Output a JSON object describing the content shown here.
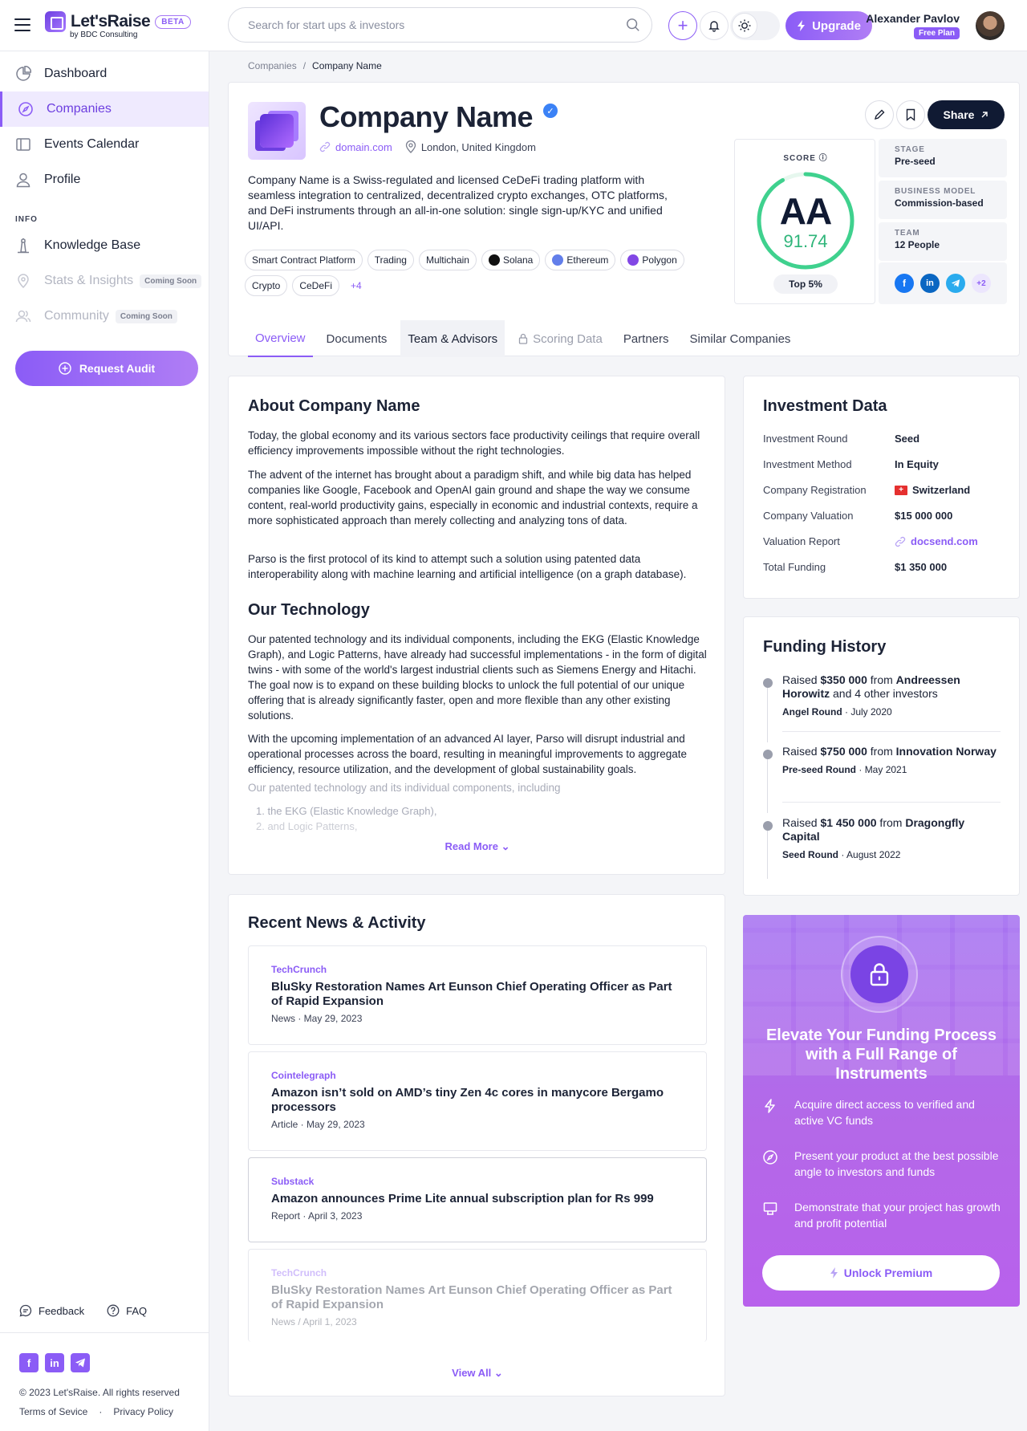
{
  "brand": {
    "name": "Let'sRaise",
    "sub": "by BDC Consulting",
    "badge": "BETA"
  },
  "search": {
    "placeholder": "Search for start ups & investors"
  },
  "topbar": {
    "upgrade_label": "Upgrade"
  },
  "user": {
    "name": "Alexander Pavlov",
    "plan": "Free Plan"
  },
  "sidebar": {
    "items": [
      {
        "label": "Dashboard"
      },
      {
        "label": "Companies"
      },
      {
        "label": "Events Calendar"
      },
      {
        "label": "Profile"
      }
    ],
    "section": "INFO",
    "info_items": [
      {
        "label": "Knowledge Base"
      },
      {
        "label": "Stats & Insights",
        "badge": "Coming Soon"
      },
      {
        "label": "Community",
        "badge": "Coming Soon"
      }
    ],
    "request_audit": "Request Audit",
    "feedback": "Feedback",
    "faq": "FAQ",
    "copyright": "© 2023 Let'sRaise. All rights reserved",
    "terms": "Terms of Sevice",
    "privacy": "Privacy Policy"
  },
  "breadcrumb": {
    "root": "Companies",
    "sep": "/",
    "current": "Company Name"
  },
  "company": {
    "name": "Company Name",
    "domain": "domain.com",
    "location": "London, United Kingdom",
    "description": "Company Name is a Swiss-regulated and licensed CeDeFi trading platform with seamless integration to centralized, decentralized crypto exchanges, OTC platforms, and DeFi instruments through an all-in-one solution: single sign-up/KYC and unified UI/API.",
    "tags": [
      "Smart Contract Platform",
      "Trading",
      "Multichain",
      "Solana",
      "Ethereum",
      "Polygon",
      "Crypto",
      "CeDeFi"
    ],
    "tags_more": "+4",
    "share_label": "Share"
  },
  "score": {
    "label": "SCORE",
    "grade": "AA",
    "value": "91.74",
    "rank": "Top 5%",
    "fraction": 0.9174,
    "ring_color": "#3fd18e"
  },
  "info": {
    "stage_k": "STAGE",
    "stage_v": "Pre-seed",
    "model_k": "BUSINESS MODEL",
    "model_v": "Commission-based",
    "team_k": "TEAM",
    "team_v": "12 People",
    "social_more": "+2"
  },
  "tabs": [
    {
      "label": "Overview"
    },
    {
      "label": "Documents"
    },
    {
      "label": "Team & Advisors"
    },
    {
      "label": "Scoring Data"
    },
    {
      "label": "Partners"
    },
    {
      "label": "Similar Companies"
    }
  ],
  "about": {
    "title": "About Company Name",
    "p1": "Today, the global economy and its various sectors face productivity ceilings that require overall efficiency improvements impossible without the right technologies.",
    "p2": "The advent of the internet has brought about a paradigm shift, and while big data has helped companies like Google, Facebook and OpenAI gain ground and shape the way we consume content, real-world productivity gains, especially in economic and industrial contexts, require a more sophisticated approach than merely collecting and analyzing tons of data.",
    "p3": "Parso is the first protocol of its kind to attempt such a solution using patented data interoperability along with machine learning and artificial intelligence (on a graph database).",
    "tech_title": "Our Technology",
    "t1": "Our patented technology and its individual components, including the EKG (Elastic Knowledge Graph), and Logic Patterns, have already had successful implementations - in the form of digital twins - with some of the world's largest industrial clients such as Siemens Energy and Hitachi. The goal now is to expand on these building blocks to unlock the full potential of our unique offering that is already significantly faster, open and more flexible than any other existing solutions.",
    "t2": "With the upcoming implementation of an advanced AI layer, Parso will disrupt industrial and operational processes across the board, resulting in meaningful improvements to aggregate efficiency, resource utilization, and the development of global sustainability goals.",
    "t3": "Our patented technology and its individual components, including",
    "li1": "1.  the EKG (Elastic Knowledge Graph),",
    "li2": "2.  and Logic Patterns,",
    "read_more": "Read More"
  },
  "news": {
    "title": "Recent News & Activity",
    "items": [
      {
        "source": "TechCrunch",
        "title": "BluSky Restoration Names Art Eunson Chief Operating Officer as Part of Rapid Expansion",
        "meta": "News  ·  May 29, 2023"
      },
      {
        "source": "Cointelegraph",
        "title": "Amazon isn’t sold on AMD’s tiny Zen 4c cores in manycore Bergamo processors",
        "meta": "Article  ·  May 29, 2023"
      },
      {
        "source": "Substack",
        "title": "Amazon announces Prime Lite annual subscription plan for Rs 999",
        "meta": "Report  ·  April 3, 2023"
      },
      {
        "source": "TechCrunch",
        "title": "BluSky Restoration Names Art Eunson Chief Operating Officer as Part of Rapid Expansion",
        "meta": "News / April 1, 2023"
      }
    ],
    "view_all": "View All"
  },
  "investment": {
    "title": "Investment Data",
    "rows": [
      {
        "k": "Investment Round",
        "v": "Seed"
      },
      {
        "k": "Investment Method",
        "v": "In Equity"
      },
      {
        "k": "Company Registration",
        "v": "Switzerland"
      },
      {
        "k": "Company Valuation",
        "v": "$15 000 000"
      },
      {
        "k": "Valuation Report",
        "v": "docsend.com"
      },
      {
        "k": "Total Funding",
        "v": "$1 350 000"
      }
    ]
  },
  "funding": {
    "title": "Funding History",
    "items": [
      {
        "pre": "Raised ",
        "amount": "$350 000",
        "mid": " from ",
        "investor": "Andreessen Horowitz",
        "post": " and 4 other investors",
        "round": "Angel Round",
        "date": "July 2020"
      },
      {
        "pre": "Raised ",
        "amount": "$750 000",
        "mid": " from ",
        "investor": "Innovation Norway",
        "post": "",
        "round": "Pre-seed Round",
        "date": "May 2021"
      },
      {
        "pre": "Raised ",
        "amount": "$1 450 000",
        "mid": " from ",
        "investor": "Dragongfly Capital",
        "post": "",
        "round": "Seed Round",
        "date": "August 2022"
      }
    ]
  },
  "premium": {
    "title": "Elevate Your Funding Process with a Full Range of Instruments",
    "f1": "Acquire direct access to verified and active VC funds",
    "f2": "Present your product at the best possible angle to investors and funds",
    "f3": "Demonstrate that your project has growth and profit potential",
    "unlock": "Unlock Premium"
  }
}
